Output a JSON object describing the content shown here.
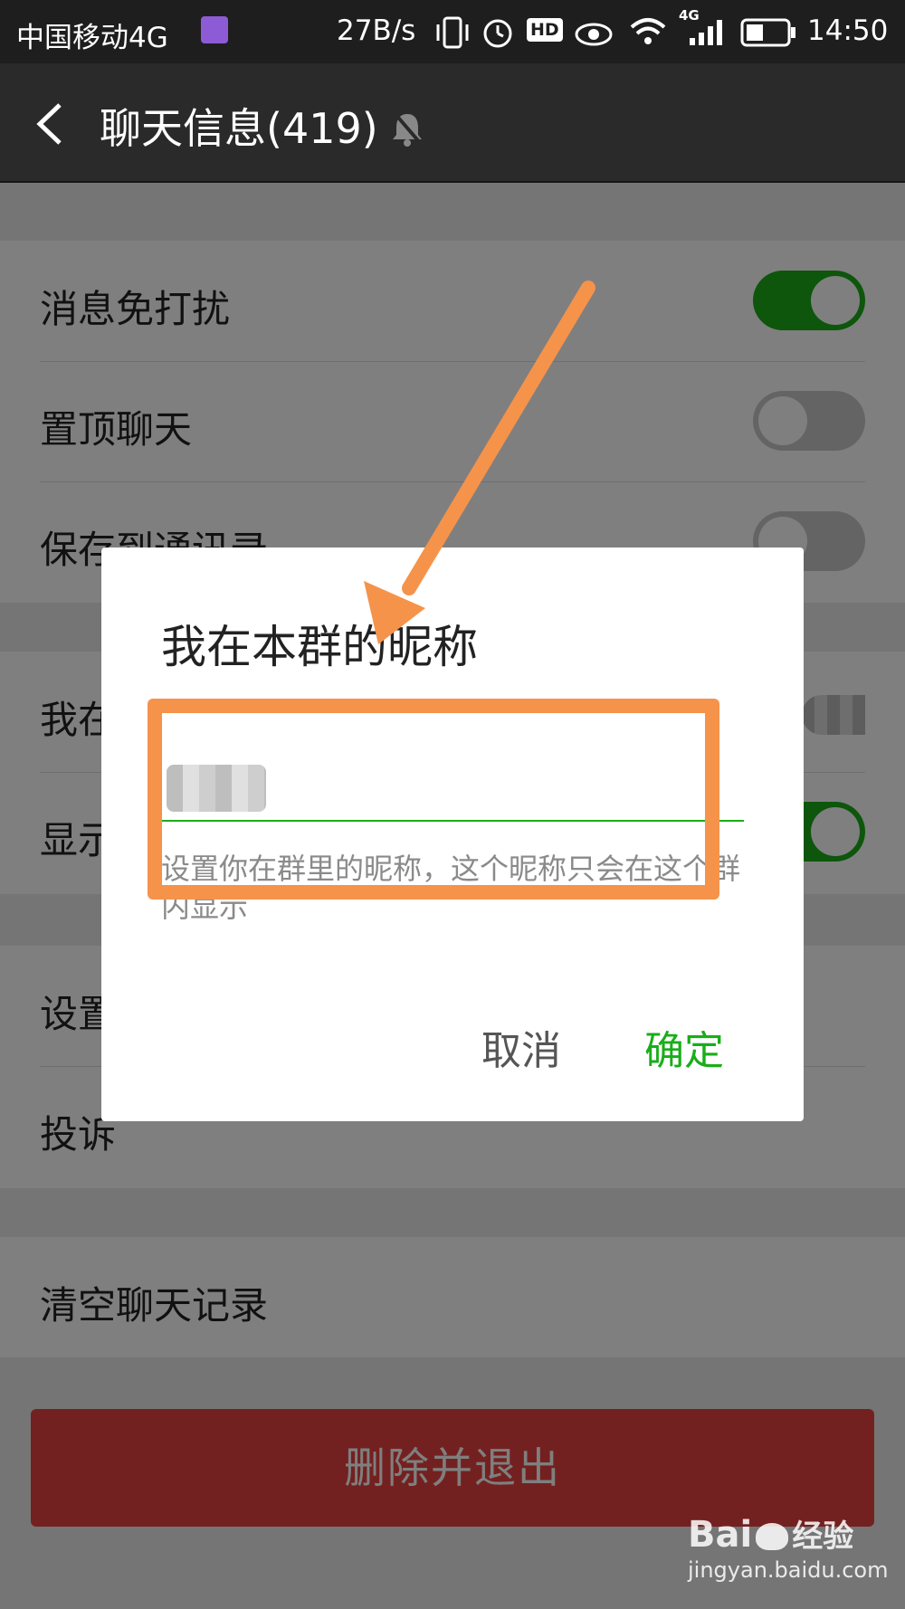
{
  "status_bar": {
    "carrier": "中国移动4G",
    "speed": "27B/s",
    "hd_badge": "HD",
    "network_badge": "4G",
    "time": "14:50"
  },
  "header": {
    "title": "聊天信息(419)"
  },
  "settings": {
    "group1": [
      {
        "label": "消息免打扰",
        "toggle": "on"
      },
      {
        "label": "置顶聊天",
        "toggle": "off"
      },
      {
        "label": "保存到通讯录",
        "toggle": "off"
      }
    ],
    "group2": [
      {
        "label": "我在本群的昵称"
      },
      {
        "label": "显示群成员昵称",
        "toggle": "on"
      }
    ],
    "group3": [
      {
        "label": "设置当前聊天背景"
      },
      {
        "label": "投诉"
      }
    ],
    "group4": [
      {
        "label": "清空聊天记录"
      }
    ],
    "delete_button": "删除并退出"
  },
  "dialog": {
    "title": "我在本群的昵称",
    "hint": "设置你在群里的昵称，这个昵称只会在这个群内显示",
    "cancel_label": "取消",
    "confirm_label": "确定"
  },
  "watermark": {
    "brand": "Bai",
    "brand_suffix": "经验",
    "url": "jingyan.baidu.com"
  },
  "colors": {
    "accent_green": "#1aad19",
    "annotation_orange": "#f5934b",
    "danger_red": "#e64340"
  }
}
